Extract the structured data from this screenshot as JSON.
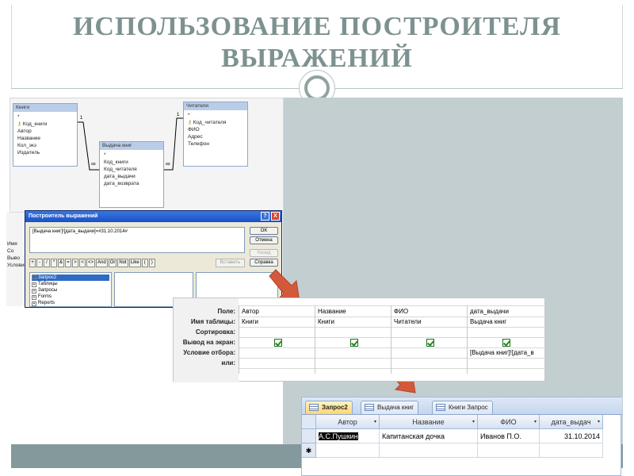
{
  "slide": {
    "title_line1": "ИСПОЛЬЗОВАНИЕ ПОСТРОИТЕЛЯ",
    "title_line2": "ВЫРАЖЕНИЙ"
  },
  "relationships": {
    "table_books": {
      "title": "Книги",
      "fields": [
        "*",
        "Код_книги",
        "Автор",
        "Название",
        "Кол_экз",
        "Издатель"
      ]
    },
    "table_issue": {
      "title": "Выдача книг",
      "fields": [
        "*",
        "Код_книги",
        "Код_читателя",
        "дата_выдачи",
        "дата_возврата"
      ]
    },
    "table_readers": {
      "title": "Читатели",
      "fields": [
        "*",
        "Код_читателя",
        "ФИО",
        "Адрес",
        "Телефон"
      ]
    },
    "one_label": "1",
    "many_label": "∞"
  },
  "sidebar_fragment": [
    "Имя",
    "Со",
    "Выво",
    "Условие"
  ],
  "expression_builder": {
    "title": "Построитель выражений",
    "help_glyph": "?",
    "close_glyph": "X",
    "expression": "[Выдача книг]![дата_выдачи]=#31.10.2014#",
    "buttons": {
      "ok": "OK",
      "cancel": "Отмена",
      "undo": "Назад",
      "help": "Справка",
      "insert": "Вставить"
    },
    "operators": [
      "+",
      "-",
      "/",
      "*",
      "&",
      "=",
      ">",
      "<",
      "<>",
      "And",
      "Or",
      "Not",
      "Like",
      "(",
      ")"
    ],
    "tree_items": [
      {
        "label": "Запрос2",
        "selected": true
      },
      {
        "label": "Таблицы",
        "selected": false
      },
      {
        "label": "Запросы",
        "selected": false
      },
      {
        "label": "Forms",
        "selected": false
      },
      {
        "label": "Reports",
        "selected": false
      }
    ]
  },
  "query_design": {
    "row_labels": [
      "Поле:",
      "Имя таблицы:",
      "Сортировка:",
      "Вывод на экран:",
      "Условие отбора:",
      "или:"
    ],
    "columns": [
      {
        "field": "Автор",
        "table": "Книги",
        "show": true,
        "criteria": ""
      },
      {
        "field": "Название",
        "table": "Книги",
        "show": true,
        "criteria": ""
      },
      {
        "field": "ФИО",
        "table": "Читатели",
        "show": true,
        "criteria": ""
      },
      {
        "field": "дата_выдачи",
        "table": "Выдача книг",
        "show": true,
        "criteria": "[Выдача книг]![дата_в"
      }
    ]
  },
  "result": {
    "tabs": [
      {
        "label": "Запрос2",
        "active": true
      },
      {
        "label": "Выдача книг",
        "active": false
      },
      {
        "label": "Книги Запрос",
        "active": false
      }
    ],
    "headers": [
      "Автор",
      "Название",
      "ФИО",
      "дата_выдач"
    ],
    "rows": [
      [
        "А.С.Пушкин",
        "Капитанская дочка",
        "Иванов П.О.",
        "31.10.2014"
      ]
    ],
    "new_row_glyph": "✱",
    "dropdown_glyph": "▾"
  },
  "colors": {
    "title": "#7d9290",
    "panel": "#c3ced1",
    "band": "#84999c",
    "arrow": "#d4593a"
  }
}
